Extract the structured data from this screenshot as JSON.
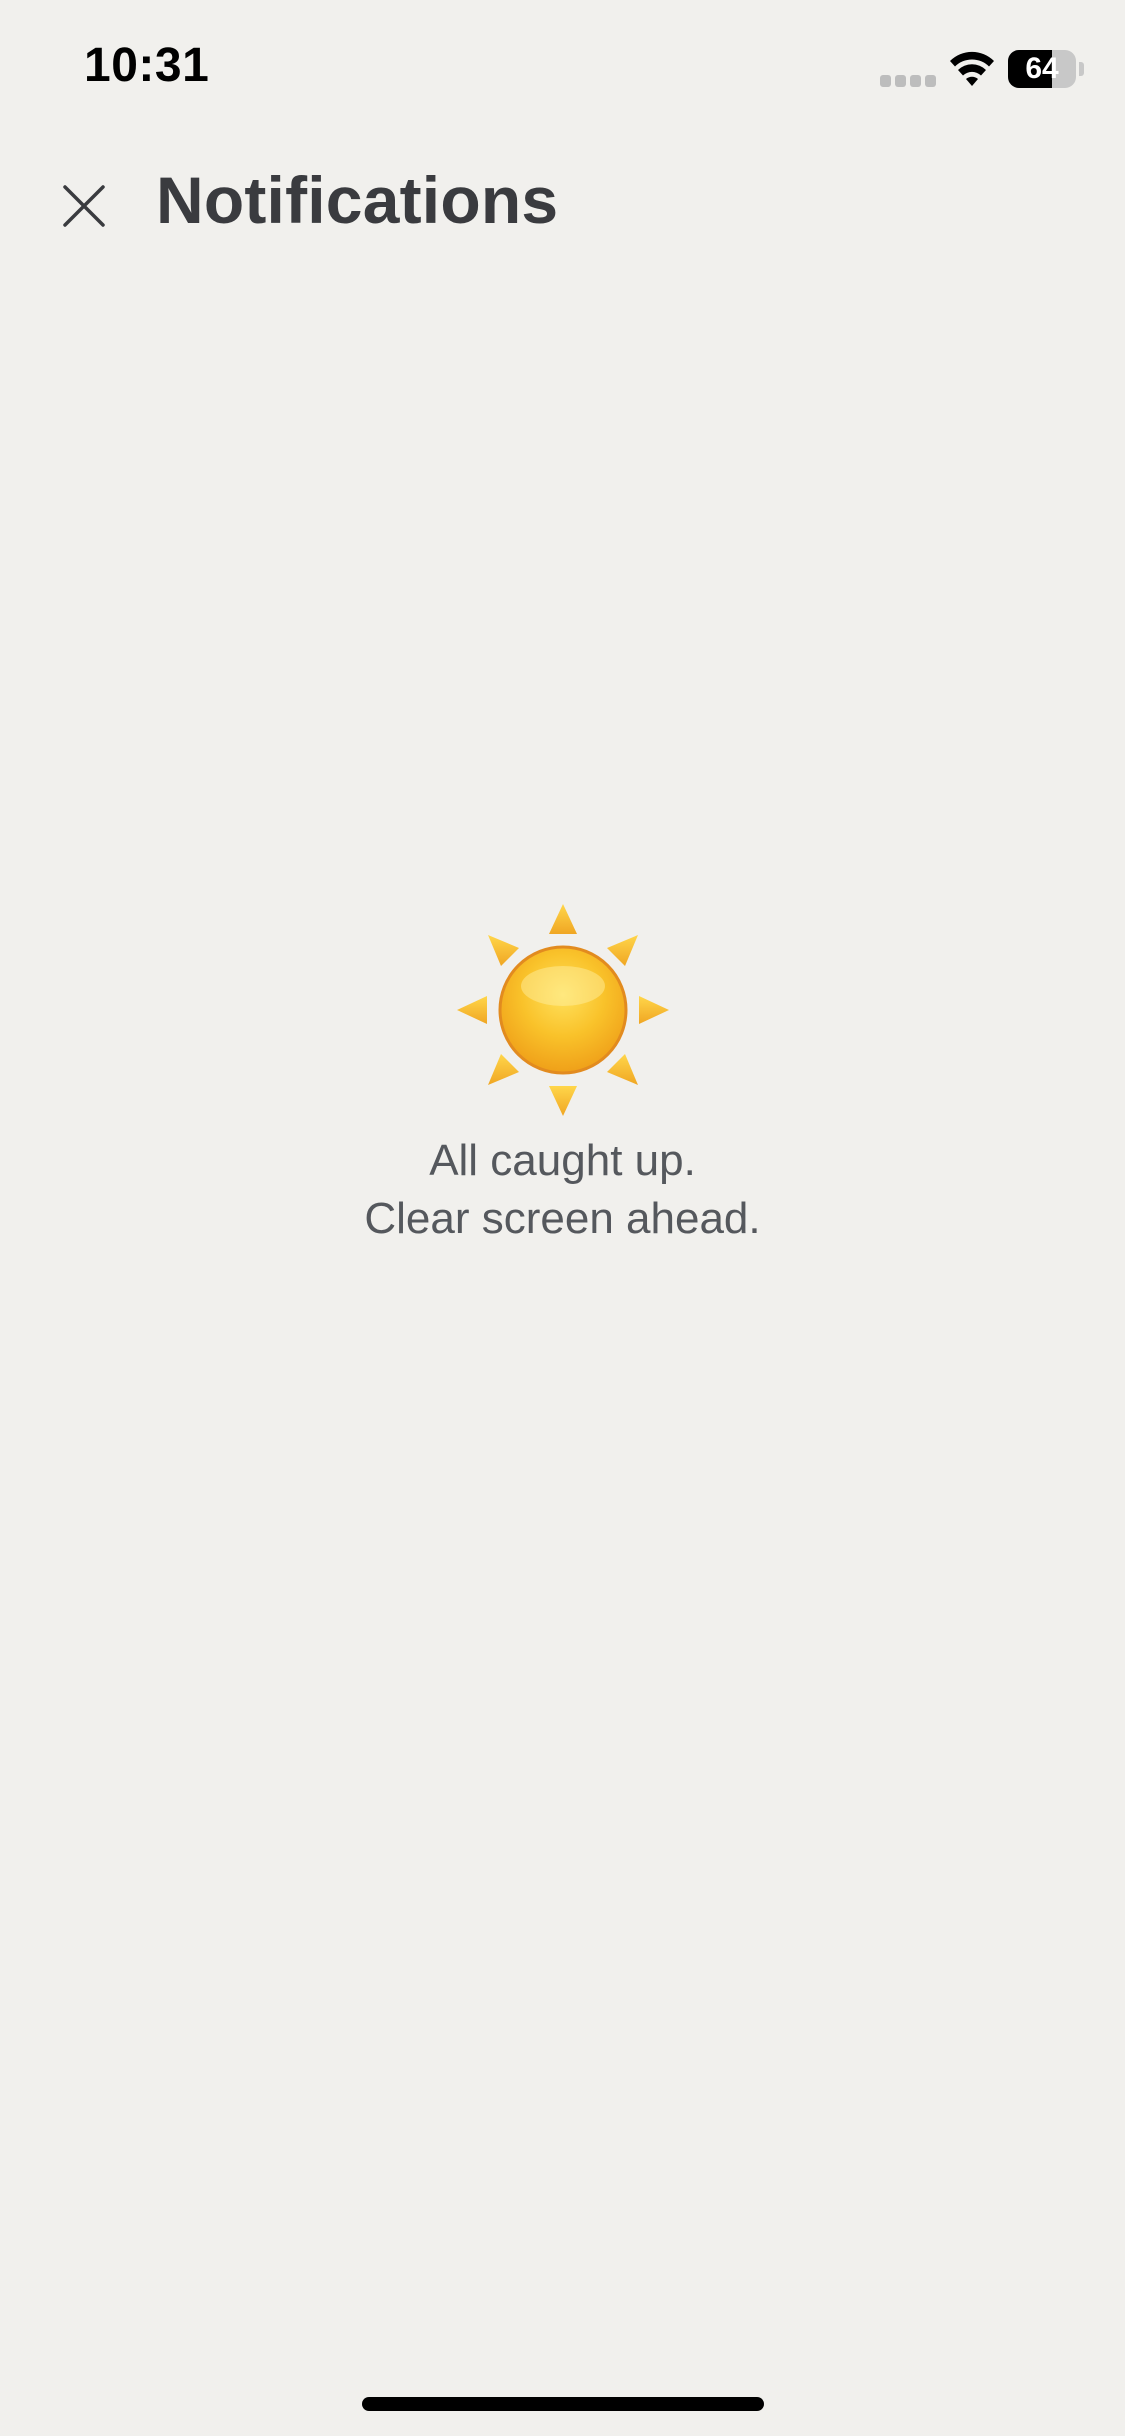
{
  "status_bar": {
    "time": "10:31",
    "battery_level": 64,
    "battery_label": "64",
    "icons": [
      "signal-icon",
      "wifi-icon",
      "battery-icon"
    ]
  },
  "header": {
    "title": "Notifications",
    "close_icon": "close-icon"
  },
  "empty_state": {
    "icon": "sun-icon",
    "line1": "All caught up.",
    "line2": "Clear screen ahead."
  },
  "colors": {
    "background": "#f1f0ed",
    "title_text": "#3a3b3f",
    "message_text": "#55585d",
    "sun_core": "#f7b51f",
    "sun_rays": "#f5c13b"
  }
}
